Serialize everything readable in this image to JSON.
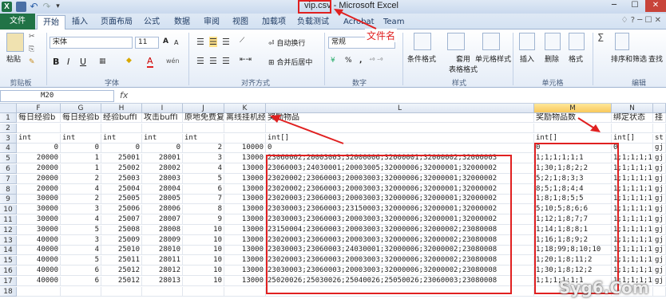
{
  "window": {
    "app_icon": "X",
    "title_file": "vip.csv",
    "title_rest": " - Microsoft Excel"
  },
  "tabs": [
    "文件",
    "开始",
    "插入",
    "页面布局",
    "公式",
    "数据",
    "审阅",
    "视图",
    "加载项",
    "负载测试",
    "Acrobat",
    "Team"
  ],
  "ribbon": {
    "clipboard": {
      "paste": "粘贴",
      "label": "剪贴板"
    },
    "font": {
      "name": "宋体",
      "size": "11",
      "label": "字体",
      "bold": "B",
      "italic": "I",
      "underline": "U",
      "grow": "A",
      "shrink": "A",
      "font_color": "A",
      "phonetic": "wén"
    },
    "alignment": {
      "wrap": "自动换行",
      "merge": "合并后居中",
      "label": "对齐方式"
    },
    "number": {
      "format": "常规",
      "label": "数字",
      "percent": "%",
      "comma": ",",
      "currency": "¥"
    },
    "styles": {
      "conditional": "条件格式",
      "table": "套用\n表格格式",
      "cell": "单元格样式",
      "label": "样式"
    },
    "cells": {
      "insert": "插入",
      "delete": "删除",
      "format": "格式",
      "label": "单元格"
    },
    "editing": {
      "sort": "排序和筛选",
      "find": "查找",
      "label": "编辑"
    }
  },
  "annotations": {
    "filename": "文件名"
  },
  "formula_bar": {
    "name_box": "M20",
    "fx": "fx"
  },
  "sheet": {
    "columns": [
      "F",
      "G",
      "H",
      "I",
      "J",
      "K",
      "L",
      "M",
      "N"
    ],
    "extra_col_header": "",
    "rows": [
      {
        "n": "1",
        "cells": [
          "每日经验b",
          "每日经验b",
          "经验buffI",
          "攻击buffI",
          "原地免费复",
          "离线挂机经",
          "奖励物品",
          "奖励物品数",
          "绑定状态",
          "挂"
        ]
      },
      {
        "n": "2",
        "cells": [
          "",
          "",
          "",
          "",
          "",
          "",
          "",
          "",
          "",
          ""
        ]
      },
      {
        "n": "3",
        "cells": [
          "int",
          "int",
          "int",
          "int",
          "int",
          "",
          "int[]",
          "int[]",
          "int[]",
          "st"
        ]
      },
      {
        "n": "4",
        "cells": [
          "0",
          "0",
          "0",
          "0",
          "2",
          "10000",
          "0",
          "0",
          "0",
          "gj"
        ]
      },
      {
        "n": "5",
        "cells": [
          "20000",
          "1",
          "25001",
          "28001",
          "3",
          "13000",
          "23060002;20003003;32000006;32000001;32000002;32000003",
          "1;1;1;1;1;1",
          "1;1;1;1;1",
          "gj"
        ]
      },
      {
        "n": "6",
        "cells": [
          "20000",
          "1",
          "25002",
          "28002",
          "4",
          "13000",
          "23060003;24030001;20003005;32000006;32000001;32000002",
          "1;30;1;8;2;2",
          "1;1;1;1;1",
          "gj"
        ]
      },
      {
        "n": "7",
        "cells": [
          "20000",
          "2",
          "25003",
          "28003",
          "5",
          "13000",
          "23020002;23060003;20003003;32000006;32000001;32000002",
          "5;2;1;8;3;3",
          "1;1;1;1;1",
          "gj"
        ]
      },
      {
        "n": "8",
        "cells": [
          "20000",
          "4",
          "25004",
          "28004",
          "6",
          "13000",
          "23020002;23060003;20003003;32000006;32000001;32000002",
          "8;5;1;8;4;4",
          "1;1;1;1;1",
          "gj"
        ]
      },
      {
        "n": "9",
        "cells": [
          "30000",
          "2",
          "25005",
          "28005",
          "7",
          "13000",
          "23020003;23060003;20003003;32000006;32000001;32000002",
          "1;8;1;8;5;5",
          "1;1;1;1;1",
          "gj"
        ]
      },
      {
        "n": "10",
        "cells": [
          "30000",
          "3",
          "25006",
          "28006",
          "8",
          "13000",
          "23030003;23060003;23150003;32000006;32000001;32000002",
          "5;10;5;8;6;6",
          "1;1;1;1;1",
          "gj"
        ]
      },
      {
        "n": "11",
        "cells": [
          "30000",
          "4",
          "25007",
          "28007",
          "9",
          "13000",
          "23030003;23060003;20003003;32000006;32000001;32000002",
          "1;12;1;8;7;7",
          "1;1;1;1;1",
          "gj"
        ]
      },
      {
        "n": "12",
        "cells": [
          "30000",
          "5",
          "25008",
          "28008",
          "10",
          "13000",
          "23150004;23060003;20003003;32000006;32000002;23080008",
          "1;14;1;8;8;1",
          "1;1;1;1;1",
          "gj"
        ]
      },
      {
        "n": "13",
        "cells": [
          "40000",
          "3",
          "25009",
          "28009",
          "10",
          "13000",
          "23020003;23060003;20003003;32000006;32000002;23080008",
          "1;16;1;8;9;2",
          "1;1;1;1;1",
          "gj"
        ]
      },
      {
        "n": "14",
        "cells": [
          "40000",
          "4",
          "25010",
          "28010",
          "10",
          "13000",
          "23030003;23060003;24030001;32000006;32000002;23080008",
          "1;18;99;8;10;10",
          "1;1;1;1;1",
          "gj"
        ]
      },
      {
        "n": "15",
        "cells": [
          "40000",
          "5",
          "25011",
          "28011",
          "10",
          "13000",
          "23020003;23060003;20003003;32000006;32000002;23080008",
          "1;20;1;8;11;2",
          "1;1;1;1;1",
          "gj"
        ]
      },
      {
        "n": "16",
        "cells": [
          "40000",
          "6",
          "25012",
          "28012",
          "10",
          "13000",
          "23030003;23060003;20003003;32000006;32000002;23080008",
          "1;30;1;8;12;2",
          "1;1;1;1;1",
          "gj"
        ]
      },
      {
        "n": "17",
        "cells": [
          "40000",
          "6",
          "25012",
          "28013",
          "10",
          "13000",
          "25020026;25030026;25040026;25050026;23060003;23080008",
          "1;1;1;1;1;1",
          "1;1;1;1;1",
          "gj"
        ]
      },
      {
        "n": "18",
        "cells": [
          "",
          "",
          "",
          "",
          "",
          "",
          "",
          "",
          "",
          ""
        ]
      }
    ]
  },
  "watermark": "Syg6.Com",
  "colors": {
    "accent": "#217346",
    "annotation": "#e02020",
    "selected_col": "#f8c85c"
  }
}
